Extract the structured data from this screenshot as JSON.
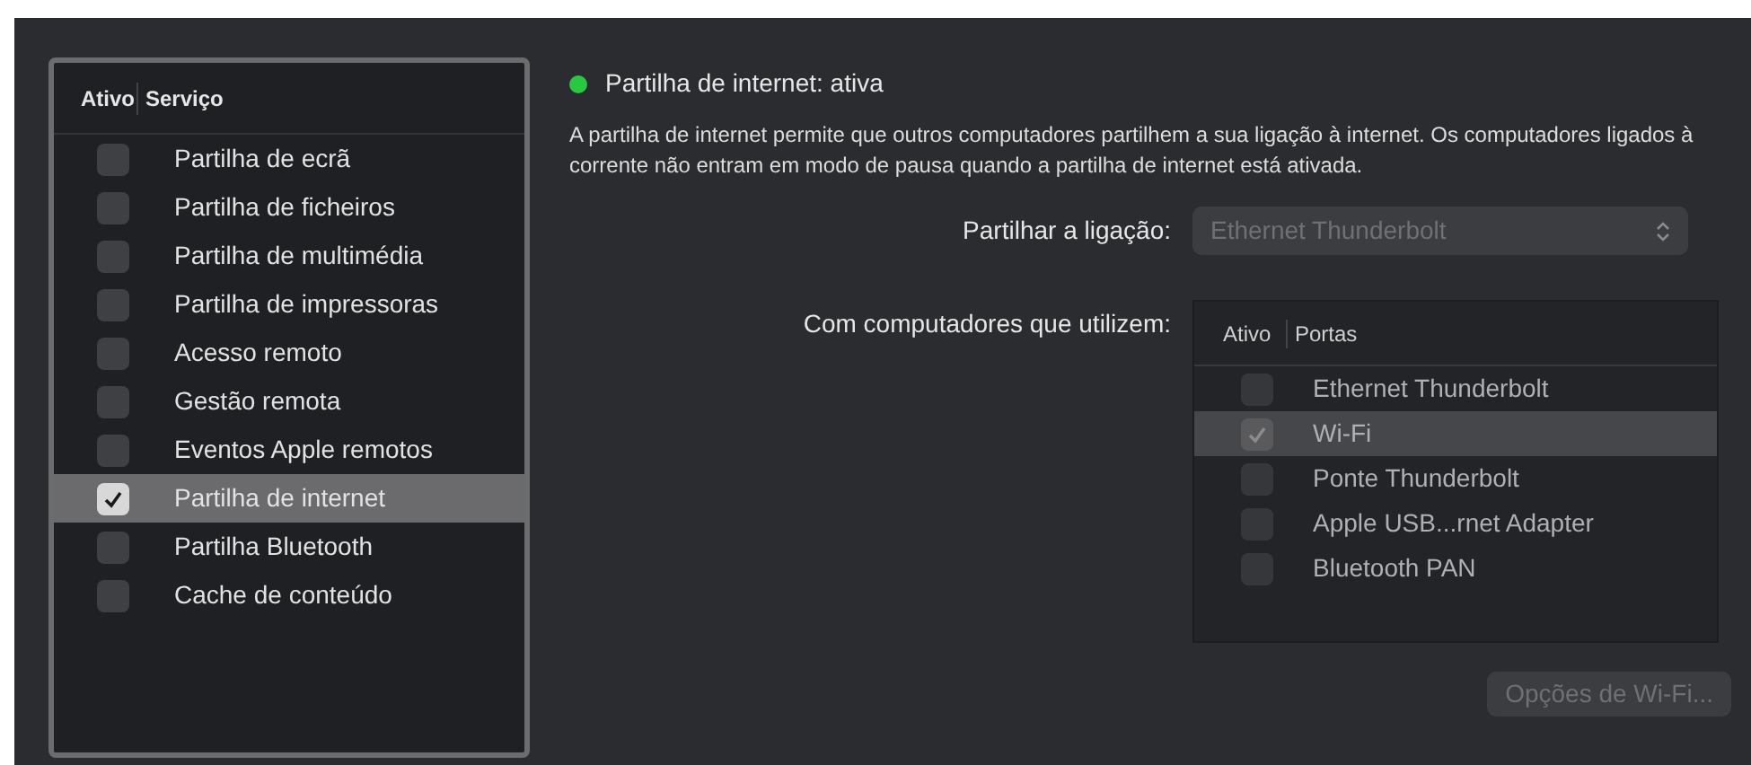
{
  "services": {
    "columns": [
      "Ativo",
      "Serviço"
    ],
    "rows": [
      {
        "label": "Partilha de ecrã",
        "checked": false,
        "selected": false
      },
      {
        "label": "Partilha de ficheiros",
        "checked": false,
        "selected": false
      },
      {
        "label": "Partilha de multimédia",
        "checked": false,
        "selected": false
      },
      {
        "label": "Partilha de impressoras",
        "checked": false,
        "selected": false
      },
      {
        "label": "Acesso remoto",
        "checked": false,
        "selected": false
      },
      {
        "label": "Gestão remota",
        "checked": false,
        "selected": false
      },
      {
        "label": "Eventos Apple remotos",
        "checked": false,
        "selected": false
      },
      {
        "label": "Partilha de internet",
        "checked": true,
        "selected": true
      },
      {
        "label": "Partilha Bluetooth",
        "checked": false,
        "selected": false
      },
      {
        "label": "Cache de conteúdo",
        "checked": false,
        "selected": false
      }
    ]
  },
  "status": {
    "title": "Partilha de internet: ativa",
    "color": "#28c840"
  },
  "description": "A partilha de internet permite que outros computadores partilhem a sua ligação à internet. Os computadores ligados à corrente não entram em modo de pausa quando a partilha de internet está ativada.",
  "share_from": {
    "label": "Partilhar a ligação:",
    "value": "Ethernet Thunderbolt",
    "disabled": true
  },
  "ports": {
    "label": "Com computadores que utilizem:",
    "disabled": true,
    "columns": [
      "Ativo",
      "Portas"
    ],
    "rows": [
      {
        "label": "Ethernet Thunderbolt",
        "checked": false,
        "selected": false
      },
      {
        "label": "Wi-Fi",
        "checked": true,
        "selected": true
      },
      {
        "label": "Ponte Thunderbolt",
        "checked": false,
        "selected": false
      },
      {
        "label": "Apple USB...rnet Adapter",
        "checked": false,
        "selected": false
      },
      {
        "label": "Bluetooth PAN",
        "checked": false,
        "selected": false
      }
    ]
  },
  "wifi_button": {
    "label": "Opções de Wi-Fi...",
    "disabled": true
  }
}
